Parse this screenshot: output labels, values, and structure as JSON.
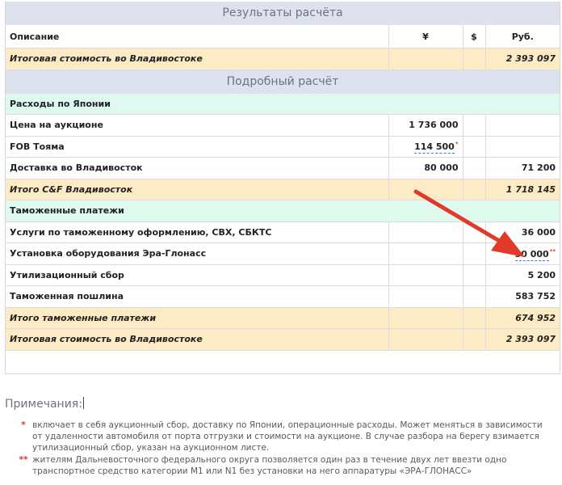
{
  "results": {
    "header": "Результаты расчёта",
    "columns": {
      "description": "Описание",
      "yen": "¥",
      "usd": "$",
      "rub": "Руб."
    },
    "total_row": {
      "label": "Итоговая стоимость во Владивостоке",
      "rub": "2 393 097"
    }
  },
  "detail": {
    "header": "Подробный расчёт",
    "japan_section": "Расходы по Японии",
    "rows_japan": [
      {
        "label": "Цена на аукционе",
        "yen": "1 736 000",
        "rub": ""
      },
      {
        "label": "FOB Тояма",
        "yen": "114 500",
        "rub": ""
      },
      {
        "label": "Доставка во Владивосток",
        "yen": "80 000",
        "rub": "71 200"
      }
    ],
    "subtotal_cf": {
      "label": "Итого C&F Владивосток",
      "rub": "1 718 145"
    },
    "customs_section": "Таможенные платежи",
    "rows_customs": [
      {
        "label": "Услуги по таможенному оформлению, СВХ, СБКТС",
        "rub": "36 000"
      },
      {
        "label": "Установка оборудования Эра-Глонасс",
        "rub": "50 000"
      },
      {
        "label": "Утилизационный сбор",
        "rub": "5 200"
      },
      {
        "label": "Таможенная пошлина",
        "rub": "583 752"
      }
    ],
    "subtotal_customs": {
      "label": "Итого таможенные платежи",
      "rub": "674 952"
    },
    "grand_total": {
      "label": "Итоговая стоимость во Владивостоке",
      "rub": "2 393 097"
    }
  },
  "notes": {
    "title": "Примечания:",
    "items": [
      {
        "mark": "*",
        "text": "включает в себя аукционный сбор, доставку по Японии, операционные расходы. Может меняться в зависимости от удаленности автомобиля от порта отгрузки и стоимости на аукционе. В случае разбора на берегу взимается утилизационный сбор, указан на аукционном листе."
      },
      {
        "mark": "**",
        "text": "жителям Дальневосточного федерального округа позволяется один раз в течение двух лет ввезти одно транспортное средство категории M1 или N1 без установки на него аппаратуры «ЭРА-ГЛОНАСС»"
      }
    ]
  },
  "colors": {
    "header_bg": "#dde2ee",
    "total_bg": "#fcebc5",
    "section_bg": "#defaef",
    "accent_red": "#d63b2f"
  },
  "icons": {
    "annotation": "red-arrow"
  }
}
